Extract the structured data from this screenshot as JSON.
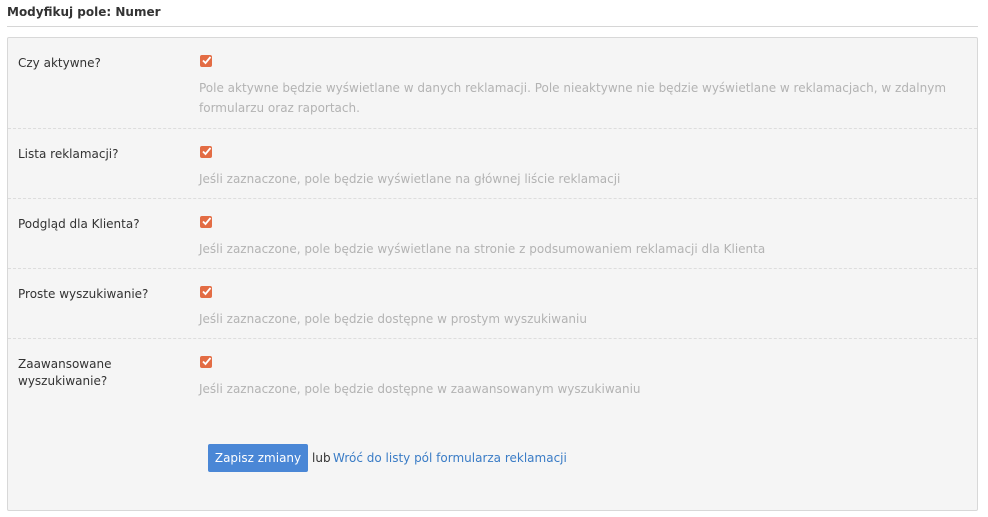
{
  "header": {
    "title": "Modyfikuj pole: Numer"
  },
  "fields": [
    {
      "label": "Czy aktywne?",
      "checked": true,
      "description": "Pole aktywne będzie wyświetlane w danych reklamacji. Pole nieaktywne nie będzie wyświetlane w reklamacjach, w zdalnym formularzu oraz raportach."
    },
    {
      "label": "Lista reklamacji?",
      "checked": true,
      "description": "Jeśli zaznaczone, pole będzie wyświetlane na głównej liście reklamacji"
    },
    {
      "label": "Podgląd dla Klienta?",
      "checked": true,
      "description": "Jeśli zaznaczone, pole będzie wyświetlane na stronie z podsumowaniem reklamacji dla Klienta"
    },
    {
      "label": "Proste wyszukiwanie?",
      "checked": true,
      "description": "Jeśli zaznaczone, pole będzie dostępne w prostym wyszukiwaniu"
    },
    {
      "label": "Zaawansowane wyszukiwanie?",
      "checked": true,
      "description": "Jeśli zaznaczone, pole będzie dostępne w zaawansowanym wyszukiwaniu"
    }
  ],
  "actions": {
    "save_label": "Zapisz zmiany",
    "or_text": "lub",
    "back_link_label": "Wróć do listy pól formularza reklamacji"
  },
  "colors": {
    "checkbox": "#e36c44",
    "primary_button": "#4a87d6",
    "link": "#3a7cc6"
  }
}
